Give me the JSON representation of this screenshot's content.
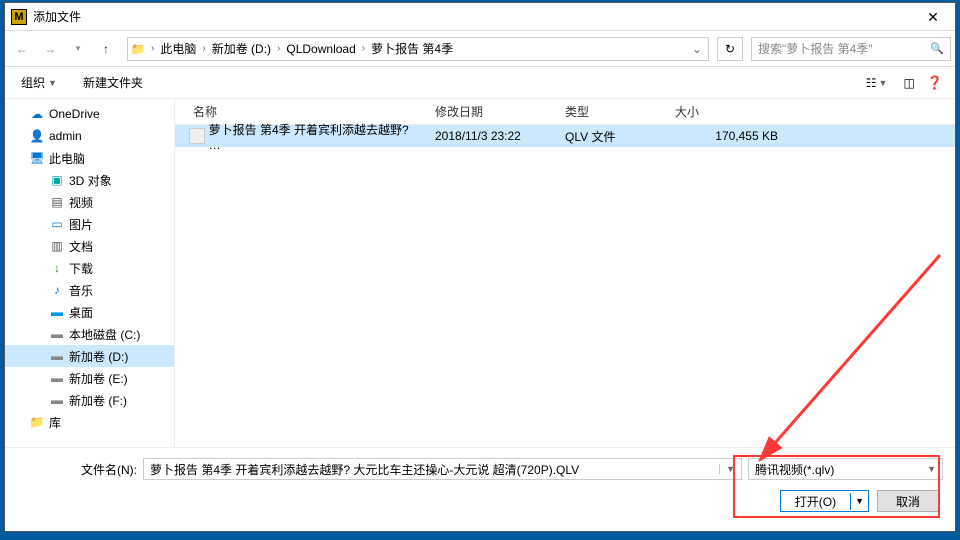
{
  "titlebar": {
    "title": "添加文件",
    "app_icon_letter": "M"
  },
  "breadcrumb": {
    "items": [
      "此电脑",
      "新加卷 (D:)",
      "QLDownload",
      "萝卜报告 第4季"
    ]
  },
  "search": {
    "placeholder": "搜索\"萝卜报告 第4季\""
  },
  "toolbar": {
    "organize": "组织",
    "newfolder": "新建文件夹"
  },
  "sidebar": {
    "items": [
      {
        "label": "OneDrive",
        "icon": "ico-onedrive",
        "level": 0,
        "glyph": "☁"
      },
      {
        "label": "admin",
        "icon": "ico-user",
        "level": 0,
        "glyph": "👤"
      },
      {
        "label": "此电脑",
        "icon": "ico-pc",
        "level": 0,
        "glyph": "🖥"
      },
      {
        "label": "3D 对象",
        "icon": "ico-3d",
        "level": 1,
        "glyph": "▣"
      },
      {
        "label": "视频",
        "icon": "ico-video",
        "level": 1,
        "glyph": "▤"
      },
      {
        "label": "图片",
        "icon": "ico-pic",
        "level": 1,
        "glyph": "▭"
      },
      {
        "label": "文档",
        "icon": "ico-doc",
        "level": 1,
        "glyph": "▥"
      },
      {
        "label": "下载",
        "icon": "ico-download",
        "level": 1,
        "glyph": "↓"
      },
      {
        "label": "音乐",
        "icon": "ico-music",
        "level": 1,
        "glyph": "♪"
      },
      {
        "label": "桌面",
        "icon": "ico-desktop",
        "level": 1,
        "glyph": "▬"
      },
      {
        "label": "本地磁盘 (C:)",
        "icon": "ico-disk",
        "level": 1,
        "glyph": "▬"
      },
      {
        "label": "新加卷 (D:)",
        "icon": "ico-disk",
        "level": 1,
        "glyph": "▬",
        "selected": true
      },
      {
        "label": "新加卷 (E:)",
        "icon": "ico-disk",
        "level": 1,
        "glyph": "▬"
      },
      {
        "label": "新加卷 (F:)",
        "icon": "ico-disk",
        "level": 1,
        "glyph": "▬"
      },
      {
        "label": "库",
        "icon": "ico-lib",
        "level": 0,
        "glyph": "📁"
      }
    ]
  },
  "columns": {
    "name": "名称",
    "date": "修改日期",
    "type": "类型",
    "size": "大小"
  },
  "files": [
    {
      "name": "萝卜报告 第4季 开着宾利添越去越野? …",
      "date": "2018/11/3 23:22",
      "type": "QLV 文件",
      "size": "170,455 KB",
      "selected": true
    }
  ],
  "bottom": {
    "filename_label": "文件名(N):",
    "filename_value": "萝卜报告 第4季 开着宾利添越去越野?  大元比车主还操心-大元说 超清(720P).QLV",
    "filter": "腾讯视频(*.qlv)",
    "open": "打开(O)",
    "cancel": "取消"
  }
}
